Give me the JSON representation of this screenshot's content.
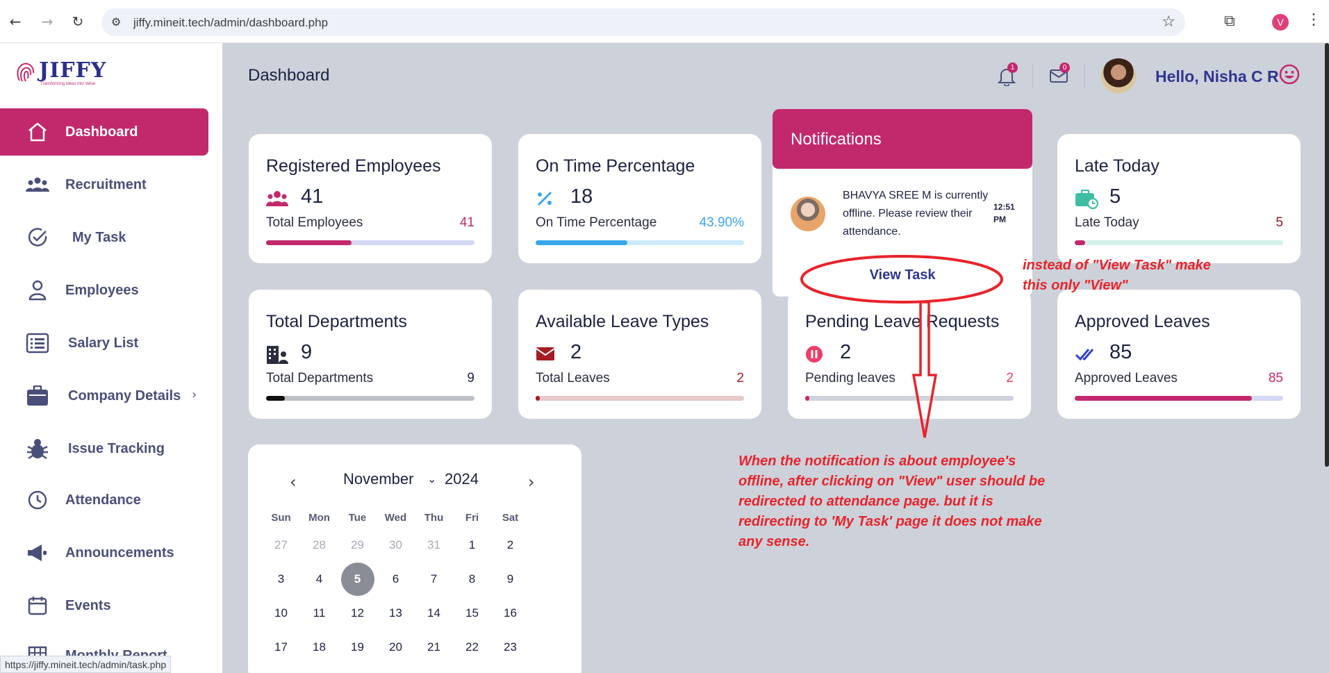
{
  "browser": {
    "url": "jiffy.mineit.tech/admin/dashboard.php",
    "profile_initial": "V",
    "status_url": "https://jiffy.mineit.tech/admin/task.php"
  },
  "brand": {
    "name": "JIFFY",
    "tagline": "Transforming Ideas into Value"
  },
  "sidebar": {
    "items": [
      {
        "label": "Dashboard",
        "icon": "home-icon",
        "active": true
      },
      {
        "label": "Recruitment",
        "icon": "users-group-icon"
      },
      {
        "label": "My Task",
        "icon": "check-circle-icon"
      },
      {
        "label": "Employees",
        "icon": "user-icon"
      },
      {
        "label": "Salary List",
        "icon": "list-icon"
      },
      {
        "label": "Company Details",
        "icon": "briefcase-icon",
        "has_submenu": true
      },
      {
        "label": "Issue Tracking",
        "icon": "bug-icon"
      },
      {
        "label": "Attendance",
        "icon": "clock-icon"
      },
      {
        "label": "Announcements",
        "icon": "megaphone-icon"
      },
      {
        "label": "Events",
        "icon": "calendar-icon"
      },
      {
        "label": "Monthly Report",
        "icon": "grid-icon"
      }
    ]
  },
  "header": {
    "title": "Dashboard",
    "notification_count": "1",
    "mail_count": "0",
    "greeting": "Hello, Nisha C R"
  },
  "cards": [
    {
      "title": "Registered Employees",
      "value": "41",
      "sub": "Total Employees",
      "num": "41",
      "fill": 0.41,
      "icon": "users-icon"
    },
    {
      "title": "On Time Percentage",
      "value": "18",
      "sub": "On Time Percentage",
      "num": "43.90%",
      "fill": 0.439,
      "icon": "percent-icon"
    },
    {
      "title": "Late Today",
      "value": "5",
      "sub": "Late Today",
      "num": "5",
      "fill": 0.05,
      "icon": "briefcase-clock-icon"
    },
    {
      "title": "Total Departments",
      "value": "9",
      "sub": "Total Departments",
      "num": "9",
      "fill": 0.09,
      "icon": "building-icon"
    },
    {
      "title": "Available Leave Types",
      "value": "2",
      "sub": "Total Leaves",
      "num": "2",
      "fill": 0.02,
      "icon": "envelope-icon"
    },
    {
      "title": "Pending Leave Requests",
      "value": "2",
      "sub": "Pending leaves",
      "num": "2",
      "fill": 0.02,
      "icon": "pause-circle-icon"
    },
    {
      "title": "Approved Leaves",
      "value": "85",
      "sub": "Approved Leaves",
      "num": "85",
      "fill": 0.85,
      "icon": "double-check-icon"
    }
  ],
  "notifications": {
    "title": "Notifications",
    "message": "BHAVYA SREE M is currently offline. Please review their attendance.",
    "time": "12:51 PM",
    "action": "View Task"
  },
  "calendar": {
    "month": "November",
    "year": "2024",
    "weekdays": [
      "Sun",
      "Mon",
      "Tue",
      "Wed",
      "Thu",
      "Fri",
      "Sat"
    ],
    "weeks": [
      [
        "27",
        "28",
        "29",
        "30",
        "31",
        "1",
        "2"
      ],
      [
        "3",
        "4",
        "5",
        "6",
        "7",
        "8",
        "9"
      ],
      [
        "10",
        "11",
        "12",
        "13",
        "14",
        "15",
        "16"
      ],
      [
        "17",
        "18",
        "19",
        "20",
        "21",
        "22",
        "23"
      ]
    ],
    "today": "5"
  },
  "annotations": {
    "note1_line1": "instead of \"View Task\" make",
    "note1_line2": "this only \"View\"",
    "note2_lines": [
      "When the notification is about employee's",
      "offline, after clicking on \"View\" user should be",
      "redirected to attendance page. but it is",
      "redirecting to 'My Task' page it does not make",
      "any sense."
    ]
  },
  "colors": {
    "brand": "#c2296c",
    "navy": "#2f3690",
    "annotation": "#e8232a"
  }
}
